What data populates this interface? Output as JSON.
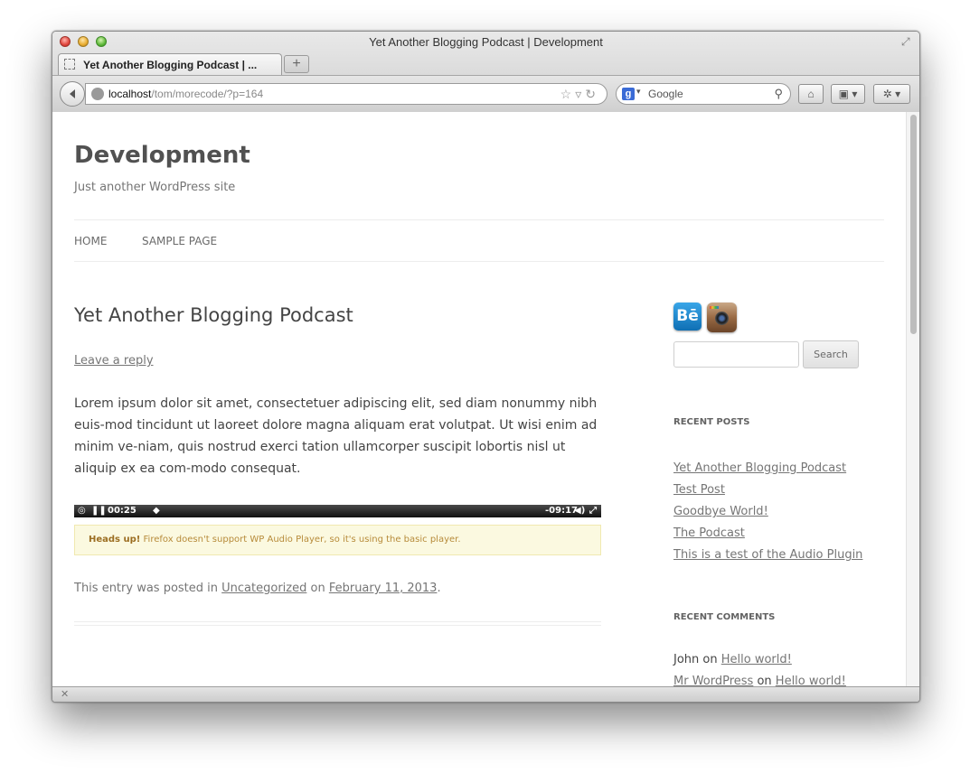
{
  "window": {
    "title": "Yet Another Blogging Podcast | Development",
    "tab_label": "Yet Another Blogging Podcast | ...",
    "new_tab": "+"
  },
  "toolbar": {
    "url_host": "localhost",
    "url_path": "/tom/morecode/?p=164",
    "search_engine": "Google",
    "search_placeholder": "Google"
  },
  "site": {
    "title": "Development",
    "description": "Just another WordPress site"
  },
  "nav": [
    {
      "label": "HOME"
    },
    {
      "label": "SAMPLE PAGE"
    }
  ],
  "post": {
    "title": "Yet Another Blogging Podcast",
    "leave_reply": "Leave a reply",
    "body": "Lorem ipsum dolor sit amet, consectetuer adipiscing elit, sed diam nonummy nibh euis-mod tincidunt ut laoreet dolore magna aliquam erat volutpat. Ut wisi enim ad minim ve-niam, quis nostrud exerci tation ullamcorper suscipit lobortis nisl ut aliquip ex ea com-modo consequat.",
    "player": {
      "elapsed": "00:25",
      "remaining": "-09:17"
    },
    "heads_up_bold": "Heads up!",
    "heads_up_text": " Firefox doesn't support WP Audio Player, so it's using the basic player.",
    "meta_prefix": "This entry was posted in ",
    "meta_category": "Uncategorized",
    "meta_on": " on ",
    "meta_date": "February 11, 2013",
    "meta_end": "."
  },
  "sidebar": {
    "search_button": "Search",
    "recent_posts_title": "RECENT POSTS",
    "recent_posts": [
      "Yet Another Blogging Podcast",
      "Test Post",
      "Goodbye World!",
      "The Podcast",
      "This is a test of the Audio Plugin"
    ],
    "recent_comments_title": "RECENT COMMENTS",
    "comments": [
      {
        "author": "John",
        "on": " on ",
        "post": "Hello world!"
      },
      {
        "author": "Mr WordPress",
        "on": " on ",
        "post": "Hello world!"
      }
    ]
  }
}
